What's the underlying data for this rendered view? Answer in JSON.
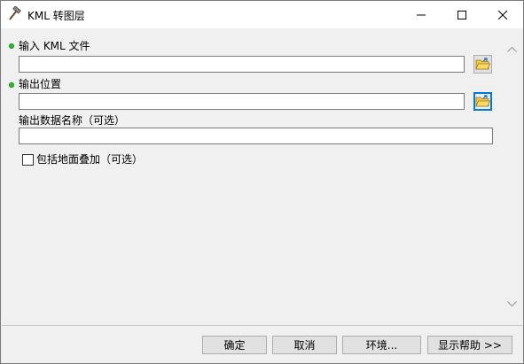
{
  "window": {
    "title": "KML 转图层"
  },
  "params": {
    "input_kml": {
      "label": "输入 KML 文件",
      "value": ""
    },
    "output_location": {
      "label": "输出位置",
      "value": ""
    },
    "output_name": {
      "label": "输出数据名称（可选）",
      "value": ""
    },
    "include_ground_overlay": {
      "label": "包括地面叠加（可选）",
      "checked": false
    }
  },
  "buttons": {
    "ok": "确定",
    "cancel": "取消",
    "environments": "环境...",
    "show_help": "显示帮助 >>"
  },
  "colors": {
    "required_dot": "#27c227",
    "active_border": "#0078d7"
  }
}
